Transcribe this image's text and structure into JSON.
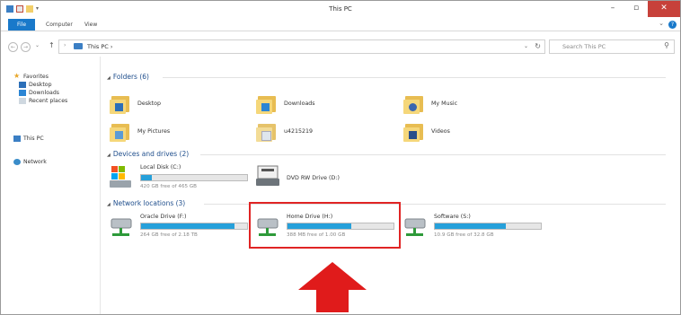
{
  "window": {
    "title": "This PC"
  },
  "ribbon": {
    "file": "File",
    "tabs": [
      "Computer",
      "View"
    ]
  },
  "address": {
    "path": "This PC",
    "separator": "›"
  },
  "search": {
    "placeholder": "Search This PC"
  },
  "nav": {
    "favorites": "Favorites",
    "desktop": "Desktop",
    "downloads": "Downloads",
    "recent": "Recent places",
    "thispc": "This PC",
    "network": "Network"
  },
  "sections": {
    "folders": "Folders (6)",
    "devices": "Devices and drives (2)",
    "network": "Network locations (3)"
  },
  "folders": [
    "Desktop",
    "Downloads",
    "My Music",
    "My Pictures",
    "u4215219",
    "Videos"
  ],
  "devices": {
    "local_disk": {
      "name": "Local Disk (C:)",
      "free": "420 GB free of 465 GB",
      "used_fraction": 0.1
    },
    "dvd": {
      "name": "DVD RW Drive (D:)"
    }
  },
  "network_drives": [
    {
      "name": "Oracle Drive (F:)",
      "free": "264 GB free of 2.18 TB",
      "used_fraction": 0.88
    },
    {
      "name": "Home Drive (H:)",
      "free": "388 MB free of 1.00 GB",
      "used_fraction": 0.6
    },
    {
      "name": "Software (S:)",
      "free": "10.9 GB free of 32.8 GB",
      "used_fraction": 0.67
    }
  ],
  "colors": {
    "accent": "#1979ca",
    "bar": "#26a0da",
    "highlight": "#e02424",
    "arrow": "#e01b1b"
  }
}
